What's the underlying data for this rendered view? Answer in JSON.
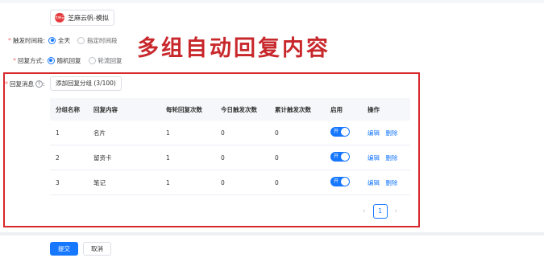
{
  "account": {
    "logo_text": "芝麻云帆",
    "name": "芝麻云帆-模拟"
  },
  "trigger_time": {
    "label": "触发时间段:",
    "options": [
      {
        "label": "全天",
        "selected": true
      },
      {
        "label": "指定时间段",
        "selected": false
      }
    ]
  },
  "reply_mode": {
    "label": "回复方式:",
    "options": [
      {
        "label": "随机回复",
        "selected": true
      },
      {
        "label": "轮流回复",
        "selected": false
      }
    ]
  },
  "overlay_title": "多组自动回复内容",
  "reply_messages": {
    "label": "回复消息",
    "info_icon": "?",
    "add_button": "添加回复分组 (3/100)"
  },
  "table": {
    "headers": [
      "分组名称",
      "回复内容",
      "每轮回复次数",
      "今日触发次数",
      "累计触发次数",
      "启用",
      "操作"
    ],
    "rows": [
      {
        "group": "1",
        "content": "名片",
        "per_round": "1",
        "today": "0",
        "total": "0",
        "enabled": "开",
        "edit": "编辑",
        "delete": "删除"
      },
      {
        "group": "2",
        "content": "留资卡",
        "per_round": "1",
        "today": "0",
        "total": "0",
        "enabled": "开",
        "edit": "编辑",
        "delete": "删除"
      },
      {
        "group": "3",
        "content": "笔记",
        "per_round": "1",
        "today": "0",
        "total": "0",
        "enabled": "开",
        "edit": "编辑",
        "delete": "删除"
      }
    ]
  },
  "pagination": {
    "prev": "‹",
    "current": "1",
    "next": "›"
  },
  "footer": {
    "submit": "提交",
    "cancel": "取消"
  },
  "colors": {
    "accent": "#1677ff",
    "highlight": "#d7282c",
    "required": "#f56c6c"
  }
}
